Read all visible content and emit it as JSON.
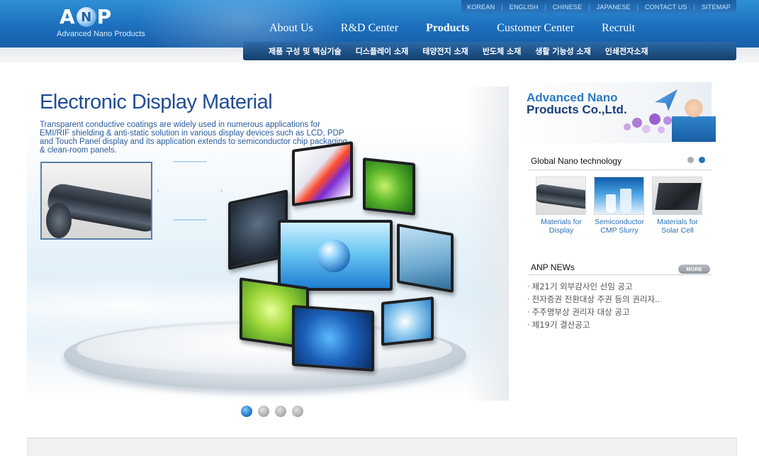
{
  "header": {
    "logo": {
      "letters": [
        "A",
        "N",
        "P"
      ],
      "subtitle": "Advanced Nano Products"
    },
    "utility_links": [
      "KOREAN",
      "ENGLISH",
      "CHINESE",
      "JAPANESE",
      "CONTACT US",
      "SITEMAP"
    ],
    "main_nav": [
      "About Us",
      "R&D Center",
      "Products",
      "Customer Center",
      "Recruit"
    ],
    "active_main_nav": "Products",
    "sub_nav": [
      "제품 구성 및 핵심기술",
      "디스플레이 소재",
      "태양전지 소재",
      "반도체 소재",
      "생활 기능성 소재",
      "인쇄전자소재"
    ]
  },
  "hero": {
    "title": "Electronic Display Material",
    "description": "Transparent conductive coatings are widely used in numerous applications for EMI/RIF shielding & anti-static solution in various display devices such as LCD, PDP and Touch Panel display and its application extends to semiconductor chip packaging & clean-room panels.",
    "slide_count": 4,
    "active_slide": 1
  },
  "brand": {
    "line1": "Advanced Nano",
    "line2": "Products Co.,Ltd."
  },
  "global_nano": {
    "title": "Global Nano technology",
    "page_count": 2,
    "active_page": 2,
    "items": [
      {
        "label_1": "Materials for",
        "label_2": "Display"
      },
      {
        "label_1": "Semiconductor",
        "label_2": "CMP Slurry"
      },
      {
        "label_1": "Materials for",
        "label_2": "Solar Cell"
      }
    ]
  },
  "news": {
    "title": "ANP NEWs",
    "more_label": "MORE",
    "items": [
      "제21기 외부감사인 선임 공고",
      "전자증권 전환대상 주권 등의 권리자..",
      "주주명부상 권리자 대상 공고",
      "제19기 결산공고"
    ]
  },
  "colors": {
    "header_blue": "#1d6fbd",
    "subnav_navy": "#153f6d",
    "title_blue": "#1f4c95",
    "link_blue": "#2b6fb3"
  }
}
